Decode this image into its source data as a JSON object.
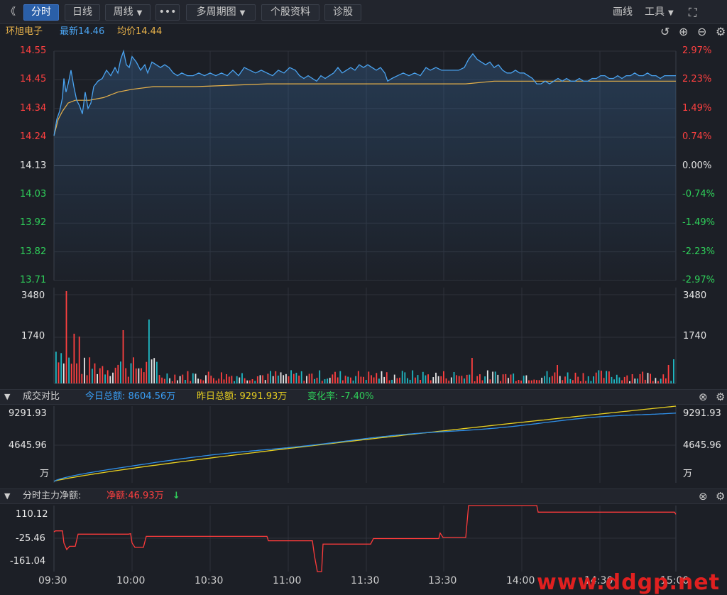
{
  "toolbar": {
    "back": "《",
    "tabs": [
      {
        "label": "分时",
        "active": true
      },
      {
        "label": "日线",
        "active": false
      },
      {
        "label": "周线",
        "active": false,
        "dropdown": true
      },
      {
        "label": "•••",
        "active": false
      },
      {
        "label": "多周期图",
        "active": false,
        "dropdown": true
      },
      {
        "label": "个股资料",
        "active": false
      },
      {
        "label": "诊股",
        "active": false
      }
    ],
    "draw_label": "画线",
    "tools_label": "工具",
    "fullscreen": "⛶"
  },
  "header": {
    "stock_name": "环旭电子",
    "latest": "最新14.46",
    "avg": "均价14.44"
  },
  "price_axis": {
    "left": [
      "14.55",
      "14.45",
      "14.34",
      "14.24",
      "14.13",
      "14.03",
      "13.92",
      "13.82",
      "13.71"
    ],
    "right": [
      "2.97%",
      "2.23%",
      "1.49%",
      "0.74%",
      "0.00%",
      "-0.74%",
      "-1.49%",
      "-2.23%",
      "-2.97%"
    ]
  },
  "volume_axis": {
    "top": "3480",
    "mid": "1740"
  },
  "compare_panel": {
    "title": "成交对比",
    "today": "今日总额: 8604.56万",
    "yesterday": "昨日总额: 9291.93万",
    "change": "变化率: -7.40%",
    "axis_top": "9291.93",
    "axis_mid": "4645.96",
    "axis_unit": "万"
  },
  "flow_panel": {
    "title": "分时主力净额:",
    "net": "净额:46.93万",
    "arrow": "↓",
    "axis": [
      "110.12",
      "-25.46",
      "-161.04"
    ]
  },
  "time_axis": [
    "09:30",
    "10:00",
    "10:30",
    "11:00",
    "11:30",
    "13:30",
    "14:00",
    "14:30",
    "15:00"
  ],
  "watermark": "www.ddgp.net",
  "colors": {
    "price": "#4aa3f0",
    "avg": "#e8b24a",
    "up": "#ff4040",
    "down": "#2fd05a",
    "today": "#2f8fe8",
    "yesterday": "#e8d020",
    "flow": "#ff3b3b"
  }
}
